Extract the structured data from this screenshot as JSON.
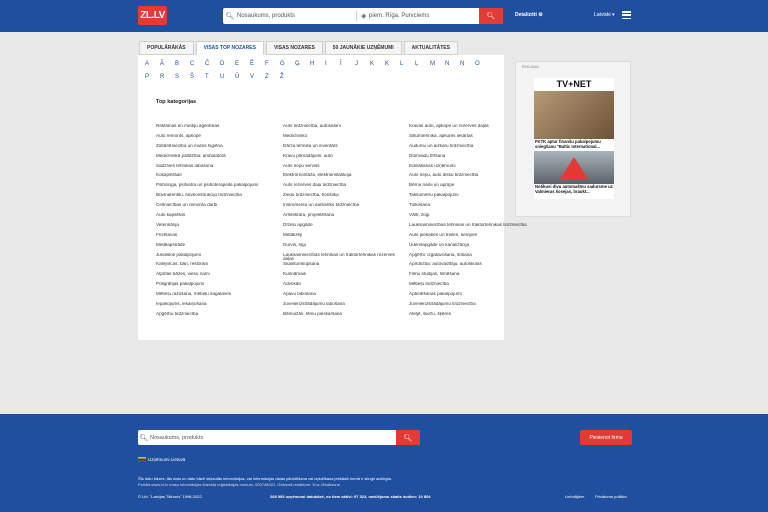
{
  "header": {
    "logo": "ZL.LV",
    "search_placeholder": "Nosaukums, produkts",
    "location_placeholder": "piem. Rīga, Purvciems",
    "advanced_label": "Detalizēti ⚙",
    "language_label": "Latviski ▾"
  },
  "tabs": [
    {
      "label": "POPULĀRĀKĀS"
    },
    {
      "label": "VISAS TOP NOZARES"
    },
    {
      "label": "VISAS NOZARES"
    },
    {
      "label": "50 JAUNĀKIE UZŅĒMUMI"
    },
    {
      "label": "AKTUALITĀTES"
    }
  ],
  "alphabet": [
    "A",
    "Ā",
    "B",
    "C",
    "Č",
    "D",
    "E",
    "Ē",
    "F",
    "G",
    "Ģ",
    "H",
    "I",
    "Ī",
    "J",
    "K",
    "Ķ",
    "L",
    "Ļ",
    "M",
    "N",
    "Ņ",
    "O",
    "P",
    "R",
    "S",
    "Š",
    "T",
    "U",
    "Ū",
    "V",
    "Z",
    "Ž"
  ],
  "top_categories_title": "Top kategorijas",
  "columns": [
    [
      "Reklāmas un mediju aģentūras",
      "Auto remonts, apkope",
      "Zobārstniecība un mutes higiēna",
      "Medicīniskā palīdzība: ambulatorā",
      "Sadzīves tehnikas labošana",
      "Kokapstrāde",
      "Psihologa, psihiatra un psihoterapeita pakalpojumi",
      "Būvmateriālu, būvkonstrukciju tirdzniecība",
      "Celtniecības un remonta darbi",
      "Auto kapsētas",
      "Veterinārija",
      "Frizētavas",
      "Metālapstrāde",
      "Juridiskie pakalpojumi",
      "Kafejnīcas, bāri, restorāni",
      "Atpūtas bāzes, viesu nami",
      "Poligrāfijas pakalpojumi",
      "Mēbeļu ražošana, mēbeļu sagataves",
      "Iepakojums, iesaiņošana",
      "Apģērbu tirdzniecība"
    ],
    [
      "Auto tirdzniecība, autosaloni",
      "Medicīnisko",
      "Dārza tehnika un inventārs",
      "Kravu pārvadājumi: auto",
      "Auto riepu serviss",
      "Elektromontāža, elektroinstalācija",
      "Auto rezerves daļu tirdzniecība",
      "Ziedu tirdzniecība, floristika",
      "Instrumentu un darbarīku tirdzniecība",
      "Arhitektūra, projektēšana",
      "Dīzeļu apgāde",
      "Metālizēji",
      "Durvis, logi",
      "Lauksaimniecības tehnikas un traktortehnikas rezerves daļas",
      "Skaistumkopšana",
      "Kurināmais",
      "Advokāti",
      "Apavu labošana",
      "Juvelierizstrādājumu labošana",
      "Bēmuižāri, lēmu pieskaršana"
    ],
    [
      "Kravas auto, apkope un rezerves daļas",
      "Siltumtehnika, apkures iekārtas",
      "Audumu un aizkaru tirdzniecība",
      "Dūmvadu tīrīšana",
      "Ēdināšanas uzņēmumi",
      "Auto riepu, auto disku tirdzniecība",
      "Bērnu nami un aprūpe",
      "Taksometru pakalpojumi",
      "Tulkošana",
      "Vārti, žogi",
      "Lauksaimniecības tehnikas un traktortehnikas tirdzniecība",
      "Auto piekabes un treileri, kemperi",
      "Ūdensapgāde un kanalizācija",
      "Apģērbi: izgatavošana, šūšana",
      "Apmācība: autovadītāju, autoskolas",
      "Filmu studijas, filmēšana",
      "Mēbeļu tirdzniecība",
      "Apbedīšanas pakalpojumi",
      "Juvelierizstrādājumu tirdzniecība",
      "Ateljē, sliežu, šķēres"
    ]
  ],
  "ad": {
    "label": "REKLĀMA",
    "brand": "TV+NET",
    "caption1": "FKTK aptur finanšu pakalpojumu sniegšanu \"Baltic International...",
    "caption2": "Notikusi divu automašīnu sadursme uz Valmieras šosejas, braukt..."
  },
  "footer": {
    "search_placeholder": "Nosaukums, produkts",
    "add_company": "Pievienot firmu",
    "lt_label": "Uzņēmumi Lietuvā",
    "disclaimer1": "Šīs datu bāzes, tās datu un datu bāzē iekļautās informācijas, vai informācijas daļas pārsūtīšana vai izplatīšana jebkādā formā ir stingri aizliegta.",
    "disclaimer2": "Portāls www.zl.lv masu informācijas līdzekļa reģistrācijas numurs: 000748422. Galvenā redaktore: Eva Jēkabsone.",
    "copyright": "© Ltd. \"Latvijas Tālrunis\" 1996-2022.",
    "stats": "268 993 uzņēmumi datubāzē, no tiem aktīvi: 97 323, meklējumu skaits šodien: 10 804",
    "link_contacts": "Lietotājiem",
    "link_privacy": "Privātuma politika"
  }
}
